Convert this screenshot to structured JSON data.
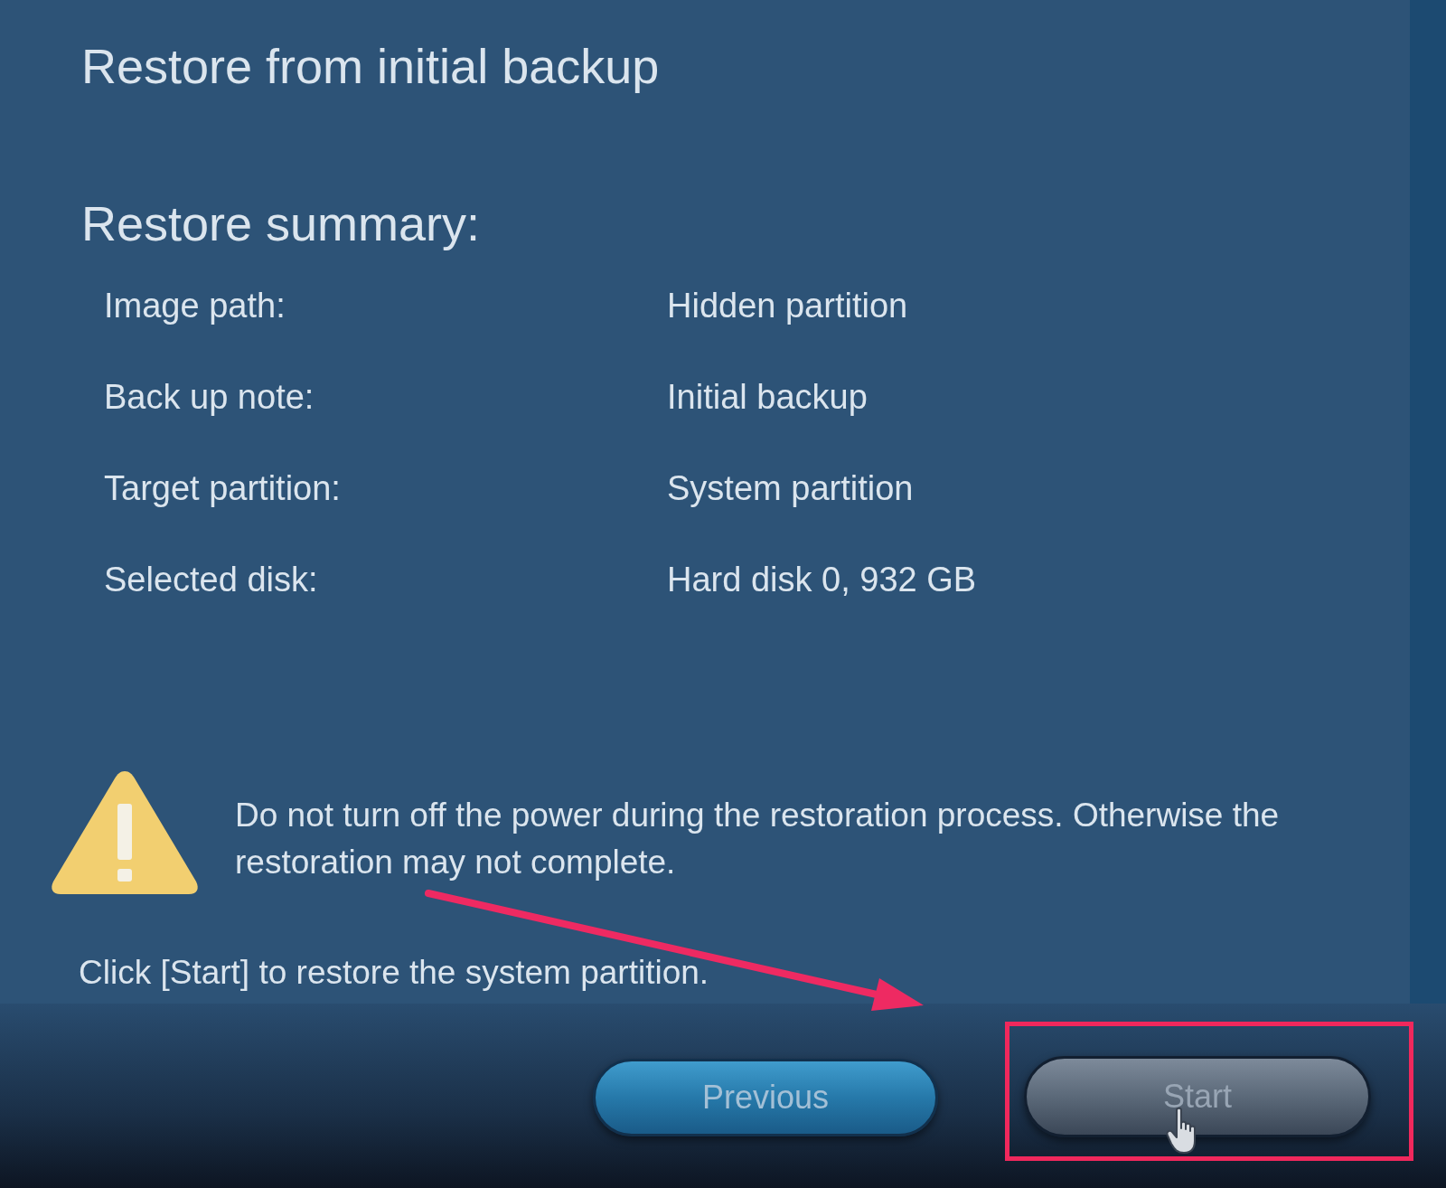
{
  "header": {
    "title": "Restore from initial backup"
  },
  "summary": {
    "heading": "Restore summary:",
    "rows": [
      {
        "label": "Image path:",
        "value": "Hidden partition"
      },
      {
        "label": "Back up note:",
        "value": "Initial backup"
      },
      {
        "label": "Target partition:",
        "value": "System partition"
      },
      {
        "label": "Selected disk:",
        "value": "Hard disk 0, 932 GB"
      }
    ]
  },
  "warning": {
    "text": "Do not turn off the power during the restoration process. Otherwise the restoration may not complete."
  },
  "instruction": "Click [Start] to restore the system partition.",
  "buttons": [
    {
      "label": "Previous",
      "hovered": false,
      "highlighted": false
    },
    {
      "label": "Start",
      "hovered": true,
      "highlighted": true
    }
  ]
}
